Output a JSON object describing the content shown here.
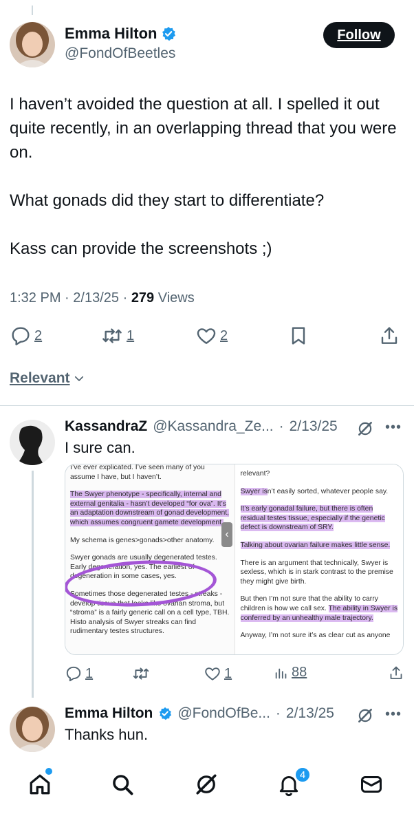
{
  "tweet": {
    "author": {
      "display_name": "Emma Hilton",
      "handle": "@FondOfBeetles",
      "verified": true
    },
    "follow_label": "Follow",
    "body": [
      "I haven’t avoided the question at all. I spelled it out quite recently, in an overlapping thread that you were on.",
      "What gonads did they start to differentiate?",
      "Kass can provide the screenshots ;)"
    ],
    "time": "1:32 PM",
    "date": "2/13/25",
    "views_count": "279",
    "views_label": "Views",
    "replies": "2",
    "reposts": "1",
    "likes": "2"
  },
  "sort": {
    "label": "Relevant"
  },
  "replies": [
    {
      "author": "KassandraZ",
      "handle": "@Kassandra_Ze...",
      "date": "2/13/25",
      "text": "I sure can.",
      "screenshot": {
        "left": {
          "p1": "I’ve ever explicated. I’ve seen many of you assume I have, but I haven’t.",
          "p2": "The Swyer phenotype - specifically, internal and external genitalia - hasn’t developed “for ova”. It’s an adaptation downstream of gonad development, which assumes congruent gamete development.",
          "p3": "My schema is genes>gonads>other anatomy.",
          "p4": "Swyer gonads are usually degenerated testes. Early degeneration, yes. The earliest of degeneration in some cases, yes.",
          "p5": "Sometimes those degenerated testes - streaks - develop tissue that looks like ovarian stroma, but “stroma” is a fairly generic call on a cell type, TBH. Histo analysis of Swyer streaks can find rudimentary testes structures."
        },
        "right": {
          "p0": "relevant?",
          "p1a": "Swyer is",
          "p1b": "n’t easily sorted, whatever people say.",
          "p2": "It’s early gonadal failure, but there is often residual testes tissue, especially if the genetic defect is downstream of SRY.",
          "p3": "Talking about ovarian failure makes little sense.",
          "p4": "There is an argument that technically, Swyer is sexless, which is in stark contrast to the premise they might give birth.",
          "p5a": "But then I’m not sure that the ability to carry children is how we call sex.",
          "p5b": "The ability in Swyer is conferred by an unhealthy male trajectory.",
          "p6": "Anyway, I’m not sure it’s as clear cut as anyone"
        }
      },
      "reply_count": "1",
      "like_count": "1",
      "view_count": "88"
    },
    {
      "author": "Emma Hilton",
      "handle": "@FondOfBe...",
      "date": "2/13/25",
      "text": "Thanks hun.",
      "verified": true
    }
  ],
  "nav": {
    "notifications_badge": "4"
  },
  "colors": {
    "accent": "#1d9bf0",
    "text": "#0f1419",
    "muted": "#536471",
    "highlight": "#be82e6"
  }
}
